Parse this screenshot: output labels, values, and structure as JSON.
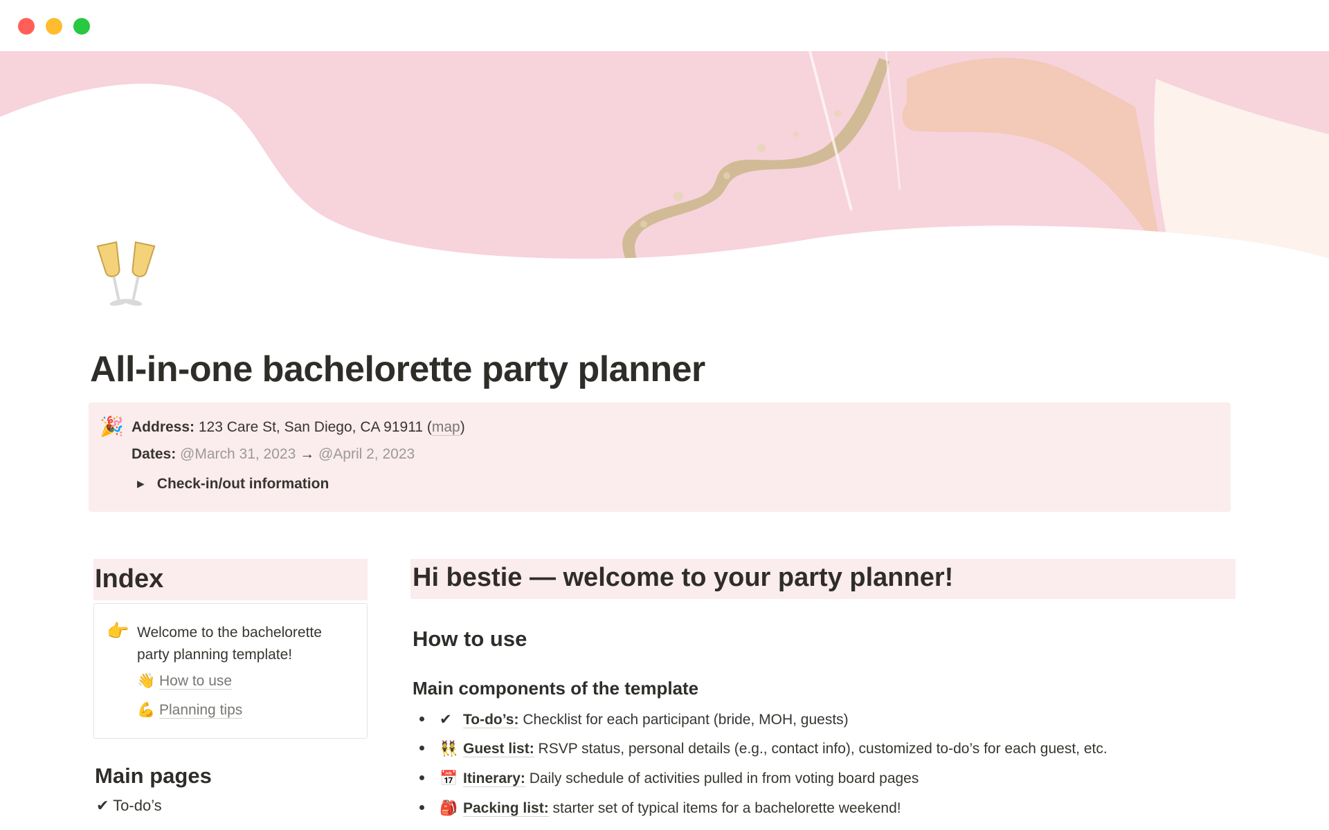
{
  "window": {
    "controls": [
      "close",
      "minimize",
      "zoom"
    ]
  },
  "cover": {
    "colors": {
      "pink": "#f7d3dc",
      "glitter": "#c9b68a",
      "white": "#ffffff"
    }
  },
  "page": {
    "icon": "champagne-glasses-icon",
    "title": "All-in-one bachelorette party planner"
  },
  "callout": {
    "icon": "party-popper-icon",
    "address_label": "Address:",
    "address_value": " 123 Care St, San Diego, CA 91911 (",
    "map_link": "map",
    "address_close": ")",
    "dates_label": "Dates:",
    "date_start": " @March 31, 2023",
    "date_arrow": " → ",
    "date_end": "@April 2, 2023",
    "toggle_label": "Check-in/out information"
  },
  "index": {
    "heading": "Index",
    "welcome_icon": "👉",
    "welcome_text": "Welcome to the bachelorette party planning template!",
    "links": [
      {
        "icon": "👋",
        "label": "How to use"
      },
      {
        "icon": "💪",
        "label": "Planning tips"
      }
    ],
    "main_pages_heading": "Main pages",
    "main_pages": [
      {
        "icon": "✔",
        "label": "To-do’s"
      }
    ]
  },
  "main": {
    "welcome_heading": "Hi bestie — welcome to your party planner!",
    "how_to_heading": "How to use",
    "components_heading": "Main components of the template",
    "components": [
      {
        "icon": "✔",
        "term": "To-do’s:",
        "desc": " Checklist for each participant (bride, MOH, guests)"
      },
      {
        "icon": "👯",
        "term": "Guest list:",
        "desc": " RSVP status, personal details (e.g., contact info), customized to-do’s for each guest, etc."
      },
      {
        "icon": "📅",
        "term": "Itinerary:",
        "desc": " Daily schedule of activities pulled in from voting board pages"
      },
      {
        "icon": "🎒",
        "term": "Packing list:",
        "desc": " starter set of typical items for a bachelorette weekend!"
      }
    ]
  },
  "colors": {
    "callout_bg": "#fbecee",
    "text": "#37352f",
    "muted": "#9b9a97"
  }
}
